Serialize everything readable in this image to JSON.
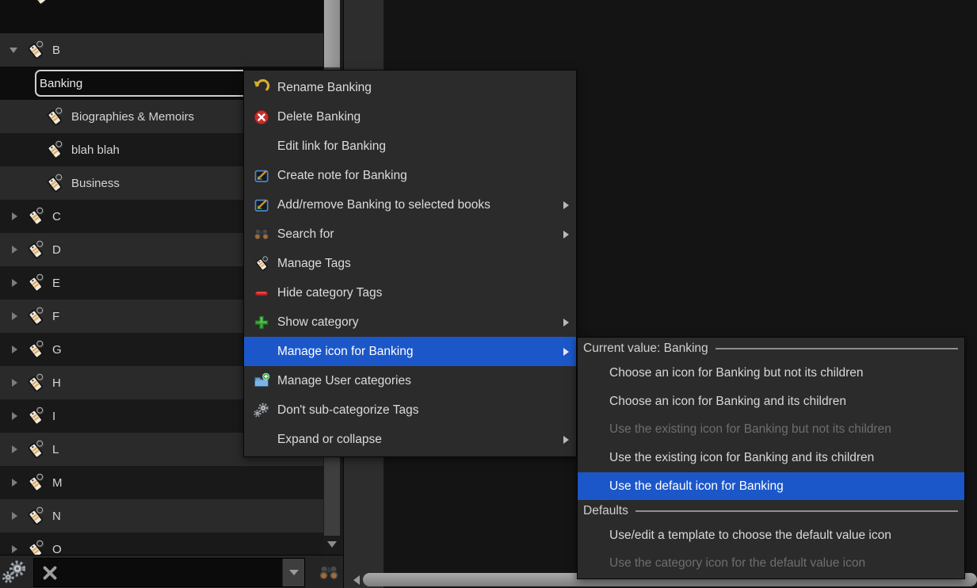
{
  "colors": {
    "highlight": "#1c57c9",
    "menu_bg": "#2b2b2b",
    "row_light": "#2a2a2a",
    "row_dark": "#191919"
  },
  "sidebar": {
    "edit_value": "Banking",
    "items": [
      {
        "label": "B"
      },
      {
        "label": "Biographies & Memoirs"
      },
      {
        "label": "blah blah"
      },
      {
        "label": "Business"
      },
      {
        "label": "C"
      },
      {
        "label": "D"
      },
      {
        "label": "E"
      },
      {
        "label": "F"
      },
      {
        "label": "G"
      },
      {
        "label": "H"
      },
      {
        "label": "I"
      },
      {
        "label": "L"
      },
      {
        "label": "M"
      },
      {
        "label": "N"
      },
      {
        "label": "O"
      }
    ]
  },
  "bottom_bar": {
    "filter_value": ""
  },
  "context_menu": {
    "items": [
      {
        "label": "Rename Banking"
      },
      {
        "label": "Delete Banking"
      },
      {
        "label": "Edit link for Banking"
      },
      {
        "label": "Create note for Banking"
      },
      {
        "label": "Add/remove Banking to selected books"
      },
      {
        "label": "Search for"
      },
      {
        "label": "Manage Tags"
      },
      {
        "label": "Hide category Tags"
      },
      {
        "label": "Show category"
      },
      {
        "label": "Manage icon for Banking"
      },
      {
        "label": "Manage User categories"
      },
      {
        "label": "Don't sub-categorize Tags"
      },
      {
        "label": "Expand or collapse"
      }
    ]
  },
  "submenu": {
    "sections": [
      {
        "header": "Current value: Banking",
        "items": [
          {
            "label": "Choose an icon for Banking but not its children",
            "state": "enabled"
          },
          {
            "label": "Choose an icon for Banking and its children",
            "state": "enabled"
          },
          {
            "label": "Use the existing icon for Banking but not its children",
            "state": "disabled"
          },
          {
            "label": "Use the existing icon for Banking and its children",
            "state": "enabled"
          },
          {
            "label": "Use the default icon for Banking",
            "state": "highlighted"
          }
        ]
      },
      {
        "header": "Defaults",
        "items": [
          {
            "label": "Use/edit a template to choose the default value icon",
            "state": "enabled"
          },
          {
            "label": "Use the category icon for the default value icon",
            "state": "disabled"
          }
        ]
      }
    ]
  }
}
